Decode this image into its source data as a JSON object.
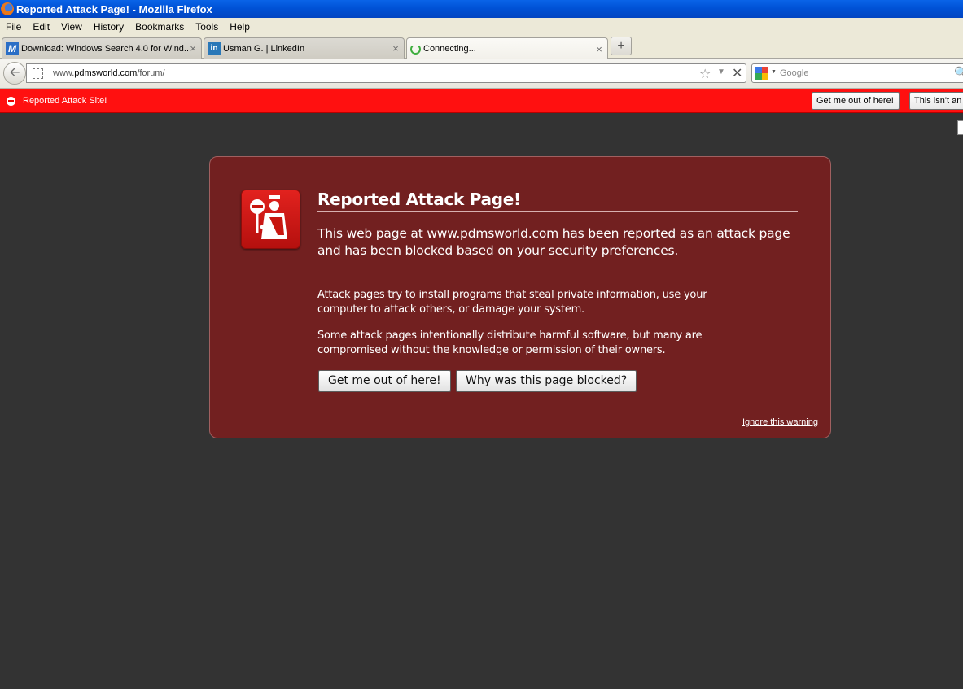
{
  "window": {
    "title": "Reported Attack Page! - Mozilla Firefox"
  },
  "menu": [
    "File",
    "Edit",
    "View",
    "History",
    "Bookmarks",
    "Tools",
    "Help"
  ],
  "tabs": [
    {
      "label": "Download: Windows Search 4.0 for Wind...",
      "close": "×",
      "favicon": "M"
    },
    {
      "label": "Usman G. | LinkedIn",
      "close": "×",
      "favicon": "in"
    },
    {
      "label": "Connecting...",
      "close": "×"
    }
  ],
  "new_tab": "+",
  "nav": {
    "url_prefix": "www.",
    "url_domain": "pdmsworld.com",
    "url_path": "/forum/",
    "search_placeholder": "Google"
  },
  "notification": {
    "text": "Reported Attack Site!",
    "get_out_label": "Get me out of here!",
    "not_attack_label": "This isn't an attack site"
  },
  "error": {
    "title": "Reported Attack Page!",
    "desc_line1": "This web page at www.pdmsworld.com has been reported as an attack page",
    "desc_line2": "and has been blocked based on your security preferences.",
    "para1_line1": "Attack pages try to install programs that steal private information, use your",
    "para1_line2": "computer to attack others, or damage your system.",
    "para2_line1": "Some attack pages intentionally distribute harmful software, but many are",
    "para2_line2": "compromised without the knowledge or permission of their owners.",
    "get_out_label": "Get me out of here!",
    "why_label": "Why was this page blocked?",
    "ignore_label": "Ignore this warning"
  },
  "colors": {
    "titlebar": "#0052d6",
    "notification": "#ff1010",
    "error_box": "#722020",
    "page_bg": "#333333"
  },
  "icons": [
    "firefox-logo-icon",
    "back-arrow-icon",
    "site-identity-icon",
    "bookmark-star-icon",
    "stop-icon",
    "google-icon",
    "search-icon",
    "warning-icon",
    "attack-site-icon"
  ]
}
